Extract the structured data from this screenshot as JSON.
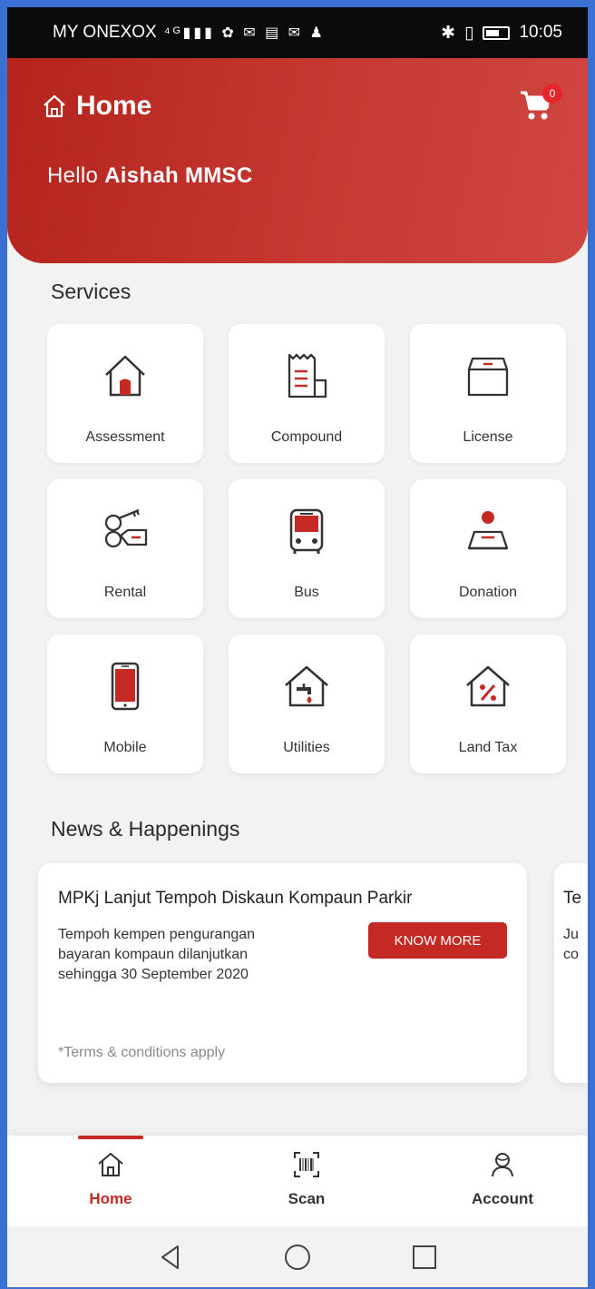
{
  "status_bar": {
    "carrier": "MY ONEXOX",
    "network": "4G",
    "time": "10:05"
  },
  "header": {
    "title": "Home",
    "greeting_prefix": "Hello",
    "user_name": "Aishah MMSC",
    "cart_count": "0"
  },
  "services": {
    "title": "Services",
    "items": [
      {
        "label": "Assessment",
        "icon": "house-icon"
      },
      {
        "label": "Compound",
        "icon": "receipt-icon"
      },
      {
        "label": "License",
        "icon": "box-icon"
      },
      {
        "label": "Rental",
        "icon": "key-tag-icon"
      },
      {
        "label": "Bus",
        "icon": "bus-icon"
      },
      {
        "label": "Donation",
        "icon": "donation-icon"
      },
      {
        "label": "Mobile",
        "icon": "mobile-phone-icon"
      },
      {
        "label": "Utilities",
        "icon": "tap-house-icon"
      },
      {
        "label": "Land Tax",
        "icon": "percent-house-icon"
      }
    ]
  },
  "news": {
    "title": "News & Happenings",
    "cards": [
      {
        "title": "MPKj Lanjut Tempoh Diskaun Kompaun Parkir",
        "body": "Tempoh kempen pengurangan bayaran kompaun dilanjutkan sehingga 30 September 2020",
        "button": "KNOW MORE",
        "terms": "*Terms & conditions apply"
      },
      {
        "title": "Te",
        "body": "Ju co"
      }
    ]
  },
  "bottom_nav": {
    "items": [
      {
        "label": "Home",
        "icon": "home-icon",
        "active": true
      },
      {
        "label": "Scan",
        "icon": "barcode-icon",
        "active": false
      },
      {
        "label": "Account",
        "icon": "user-icon",
        "active": false
      }
    ]
  },
  "colors": {
    "brand_red": "#c42a23",
    "background": "#f2f2f2",
    "frame_blue": "#3a6fd4"
  }
}
